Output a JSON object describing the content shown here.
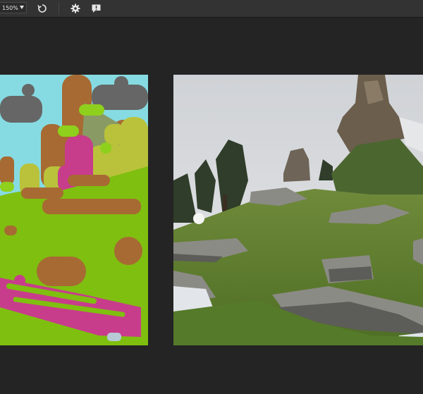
{
  "toolbar": {
    "zoom_value": "150%",
    "icons": [
      "chevron-down-icon",
      "reset-icon",
      "gear-icon",
      "feedback-icon"
    ]
  },
  "colors": {
    "background": "#242424",
    "toolbar": "#333333",
    "sky": "#86dbe2",
    "grass": "#7fbf10",
    "dirt": "#a76a33",
    "rock_gray": "#666666",
    "tree": "#b9c23a",
    "flower": "#c83c8c"
  }
}
